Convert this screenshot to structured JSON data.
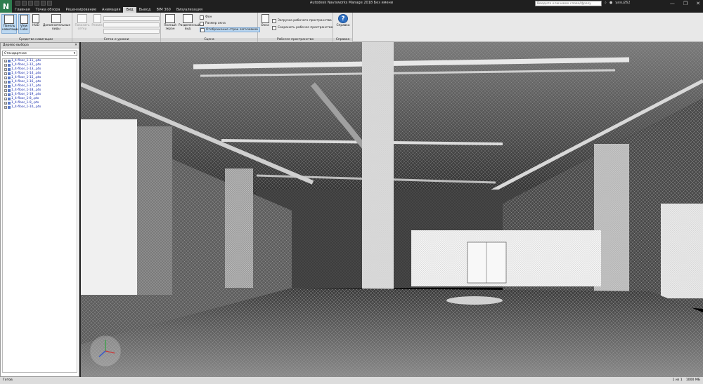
{
  "window": {
    "app_letter": "N",
    "title": "Autodesk Navisworks Manage 2018    Без имени",
    "search_placeholder": "Введите ключевое слово/фразу",
    "user": "yasu262",
    "controls": [
      "—",
      "❐",
      "✕"
    ]
  },
  "tabs": [
    "Главная",
    "Точка обзора",
    "Рецензирование",
    "Анимация",
    "Вид",
    "Вывод",
    "BIM 360",
    "Визуализация"
  ],
  "active_tab": "Вид",
  "ribbon": {
    "nav": {
      "label": "Средства навигации",
      "nav_bar": "Панель навигации",
      "view_cube": "View Cube",
      "hud": "HUD",
      "extra_views": "Дополнительные виды"
    },
    "grids": {
      "label": "Сетки и уровни",
      "show_grid": "Показать сетку",
      "mode": "Режим"
    },
    "scene": {
      "label": "Сцена",
      "fullscreen": "Полный экран",
      "split_view": "Разделенный вид",
      "background": "Фон",
      "window_size": "Размер окна",
      "show_headers": "Отображение строк заголовков"
    },
    "workspace": {
      "label": "Рабочее пространство",
      "windows": "Окна",
      "load_ws": "Загрузка рабочего пространства",
      "save_ws": "Сохранить рабочее пространство"
    },
    "help": {
      "label": "Справка",
      "help": "Справка"
    }
  },
  "sidebar": {
    "title": "Дерево выбора",
    "mode": "Стандартное",
    "items": [
      "1_4-floor_1-11_.ptx",
      "1_4-floor_1-12_.ptx",
      "1_4-floor_1-13_.ptx",
      "1_4-floor_1-14_.ptx",
      "1_4-floor_1-15_.ptx",
      "1_4-floor_1-16_.ptx",
      "1_4-floor_1-17_.ptx",
      "1_4-floor_1-18_.ptx",
      "1_4-floor_1-19_.ptx",
      "1_4-floor_1-8_.ptx",
      "1_4-floor_1-9_.ptx",
      "1_4-floor_1-10_.ptx"
    ]
  },
  "status": {
    "left": "Готов",
    "page": "1 из 1",
    "memory": "1000 МБ"
  }
}
